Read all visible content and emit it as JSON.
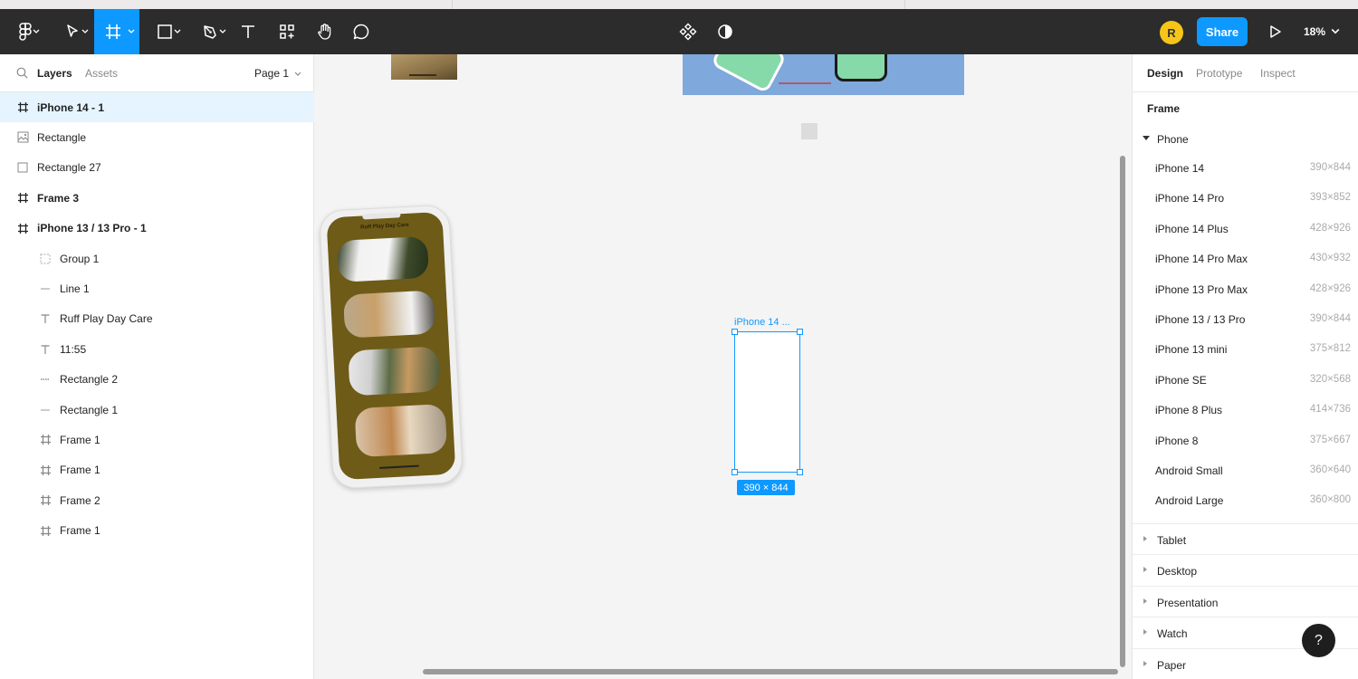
{
  "toolbar": {
    "zoom": "18%",
    "share_label": "Share",
    "avatar_initial": "R"
  },
  "left_panel": {
    "tabs": [
      "Layers",
      "Assets"
    ],
    "page": "Page 1",
    "layers": [
      {
        "label": "iPhone 14 - 1",
        "icon": "frame-icon",
        "bold": true,
        "selected": true,
        "indent": 0
      },
      {
        "label": "Rectangle",
        "icon": "image-icon",
        "bold": false,
        "indent": 0
      },
      {
        "label": "Rectangle 27",
        "icon": "rectangle-icon",
        "bold": false,
        "indent": 0
      },
      {
        "label": "Frame 3",
        "icon": "frame-icon",
        "bold": true,
        "indent": 0
      },
      {
        "label": "iPhone 13 / 13 Pro - 1",
        "icon": "frame-icon",
        "bold": true,
        "indent": 0
      },
      {
        "label": "Group 1",
        "icon": "group-icon",
        "bold": false,
        "indent": 1
      },
      {
        "label": "Line 1",
        "icon": "line-icon",
        "bold": false,
        "indent": 1
      },
      {
        "label": "Ruff Play Day Care",
        "icon": "text-icon",
        "bold": false,
        "indent": 1
      },
      {
        "label": "11:55",
        "icon": "text-icon",
        "bold": false,
        "indent": 1
      },
      {
        "label": "Rectangle 2",
        "icon": "dashed-line-icon",
        "bold": false,
        "indent": 1
      },
      {
        "label": "Rectangle 1",
        "icon": "line-icon",
        "bold": false,
        "indent": 1
      },
      {
        "label": "Frame 1",
        "icon": "frame-icon",
        "bold": false,
        "indent": 1
      },
      {
        "label": "Frame 1",
        "icon": "frame-icon",
        "bold": false,
        "indent": 1
      },
      {
        "label": "Frame 2",
        "icon": "frame-icon",
        "bold": false,
        "indent": 1
      },
      {
        "label": "Frame 1",
        "icon": "frame-icon",
        "bold": false,
        "indent": 1
      }
    ]
  },
  "canvas": {
    "frame_label": "iPhone 14 ...",
    "frame_size": "390 × 844",
    "mockup_title": "Ruff Play Day Care"
  },
  "right_panel": {
    "tabs": [
      "Design",
      "Prototype",
      "Inspect"
    ],
    "section": "Frame",
    "group_open": "Phone",
    "presets": [
      {
        "name": "iPhone 14",
        "size": "390×844"
      },
      {
        "name": "iPhone 14 Pro",
        "size": "393×852"
      },
      {
        "name": "iPhone 14 Plus",
        "size": "428×926"
      },
      {
        "name": "iPhone 14 Pro Max",
        "size": "430×932"
      },
      {
        "name": "iPhone 13 Pro Max",
        "size": "428×926"
      },
      {
        "name": "iPhone 13 / 13 Pro",
        "size": "390×844"
      },
      {
        "name": "iPhone 13 mini",
        "size": "375×812"
      },
      {
        "name": "iPhone SE",
        "size": "320×568"
      },
      {
        "name": "iPhone 8 Plus",
        "size": "414×736"
      },
      {
        "name": "iPhone 8",
        "size": "375×667"
      },
      {
        "name": "Android Small",
        "size": "360×640"
      },
      {
        "name": "Android Large",
        "size": "360×800"
      }
    ],
    "categories": [
      "Tablet",
      "Desktop",
      "Presentation",
      "Watch",
      "Paper"
    ]
  },
  "help_label": "?",
  "colors": {
    "accent": "#0d99ff",
    "toolbar": "#2c2c2c",
    "avatar": "#f5c518",
    "selection": "#e5f4ff"
  }
}
